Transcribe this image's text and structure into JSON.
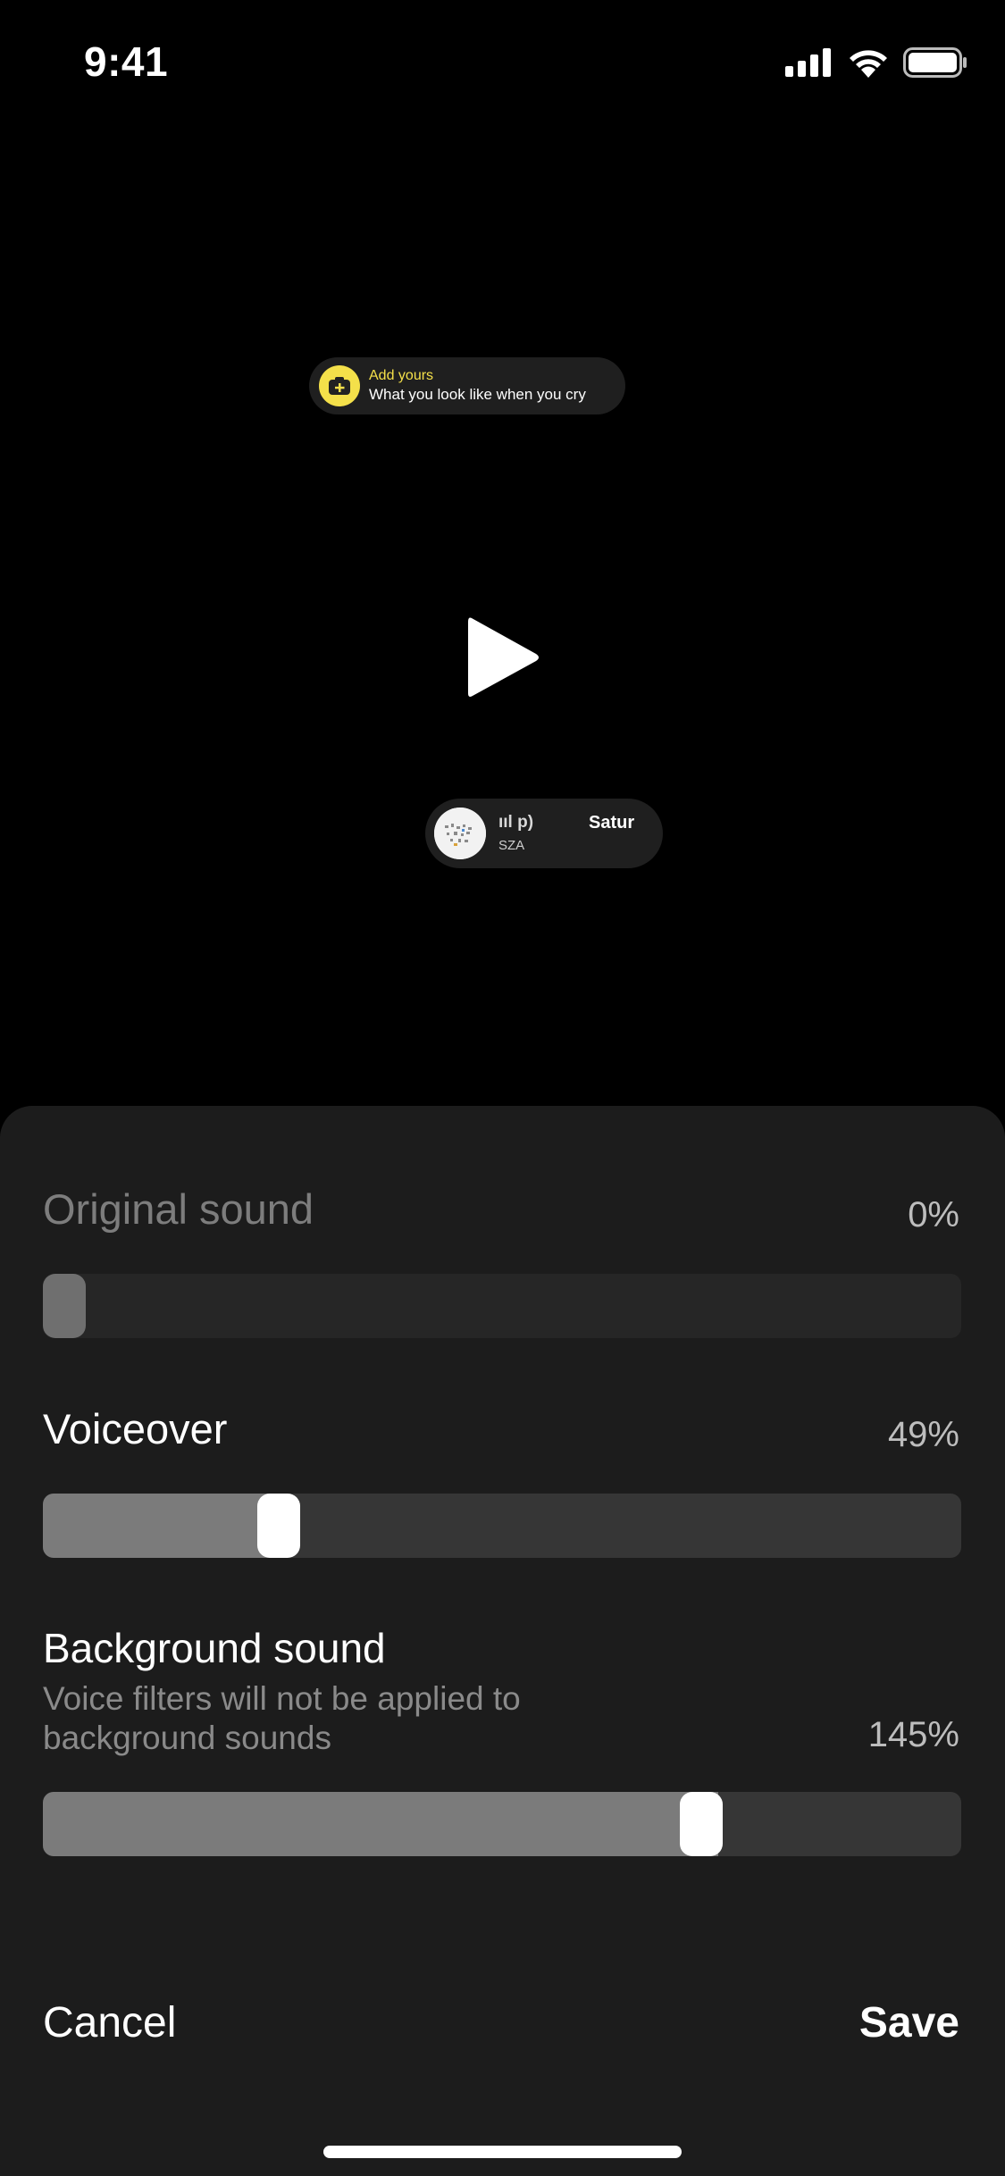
{
  "status_bar": {
    "time": "9:41",
    "icons": [
      "cellular-signal-icon",
      "wifi-icon",
      "battery-icon"
    ]
  },
  "preview": {
    "add_yours": {
      "label": "Add yours",
      "prompt": "What you look like when you cry",
      "icon": "camera-plus-icon",
      "accent_color": "#f4e04a"
    },
    "play_icon": "play-icon",
    "music": {
      "song_left": "ııl p)",
      "song_right": "Satur",
      "artist": "SZA"
    }
  },
  "sheet": {
    "original_sound": {
      "label": "Original sound",
      "value": "0%",
      "level": 0.0
    },
    "voiceover": {
      "label": "Voiceover",
      "value": "49%",
      "level": 0.245
    },
    "background_sound": {
      "label": "Background sound",
      "description": "Voice filters will not be applied to background sounds",
      "value": "145%",
      "level": 0.725
    },
    "cancel_label": "Cancel",
    "save_label": "Save"
  }
}
